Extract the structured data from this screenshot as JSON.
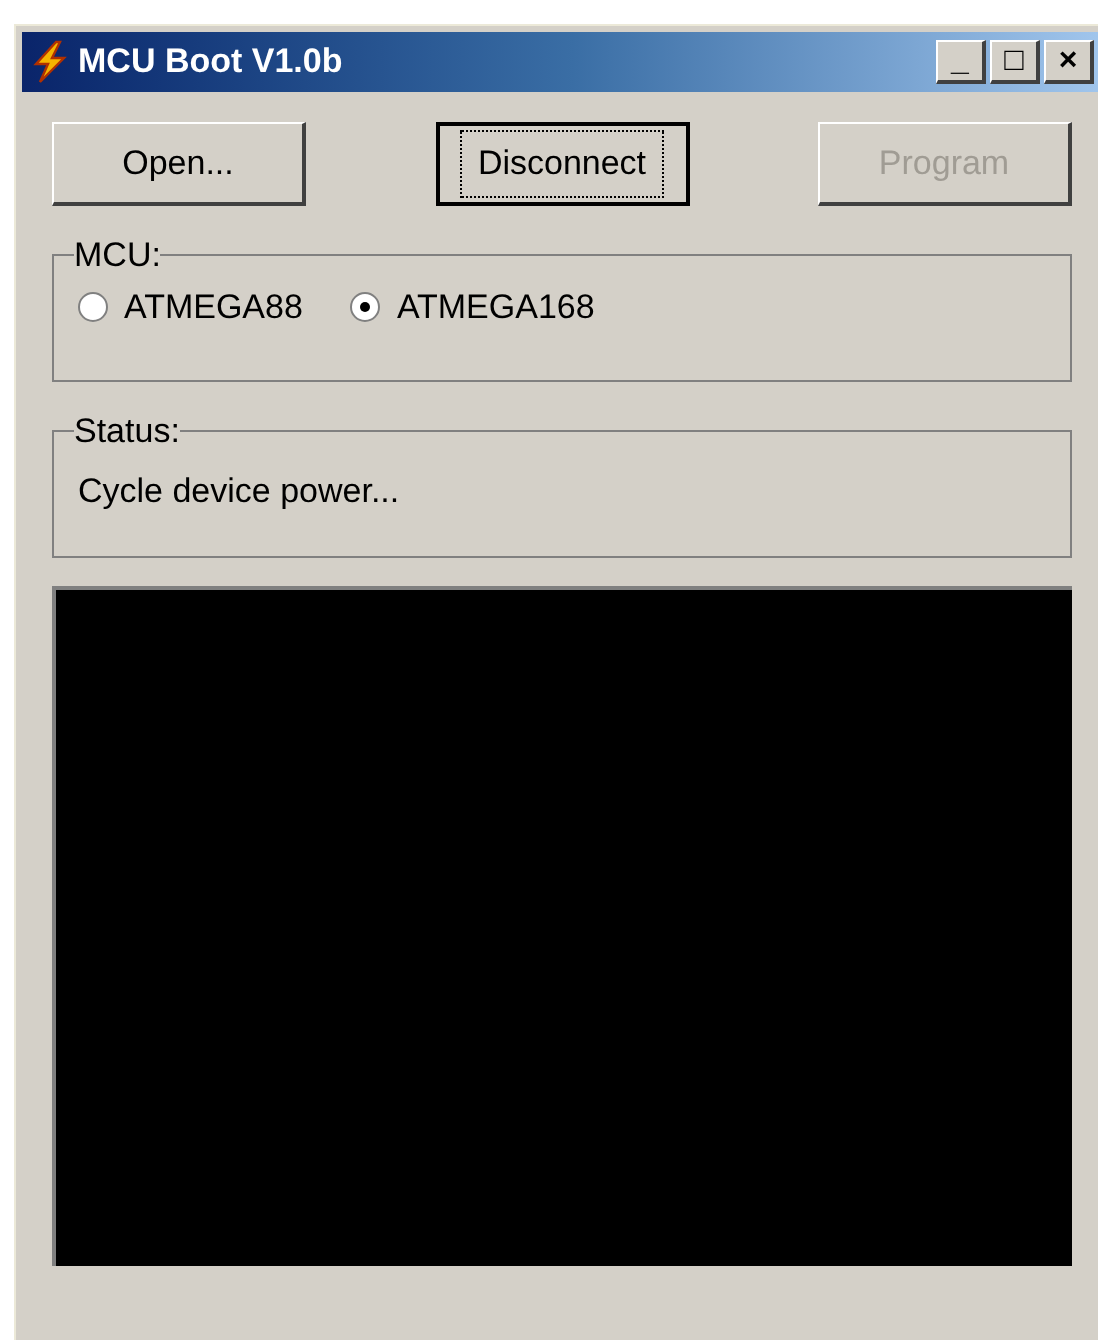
{
  "window": {
    "title": "MCU Boot V1.0b"
  },
  "title_buttons": [
    "_",
    "□",
    "×"
  ],
  "buttons": [
    {
      "label": "Open...",
      "disabled": false,
      "focused": false
    },
    {
      "label": "Disconnect",
      "disabled": false,
      "focused": true
    },
    {
      "label": "Program",
      "disabled": true,
      "focused": false
    }
  ],
  "mcu": {
    "label": "MCU:",
    "options": [
      {
        "label": "ATMEGA88",
        "selected": false
      },
      {
        "label": "ATMEGA168",
        "selected": true
      }
    ]
  },
  "status": {
    "label": "Status:",
    "text": "Cycle device power..."
  }
}
